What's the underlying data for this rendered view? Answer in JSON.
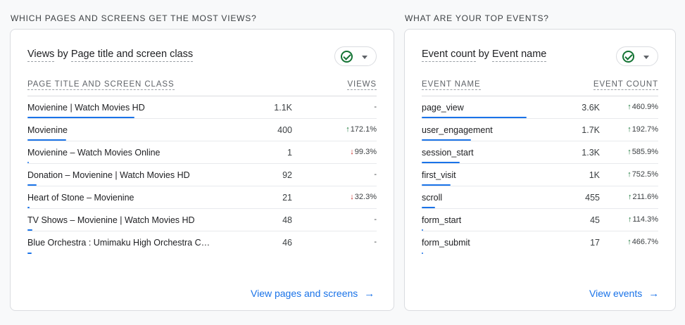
{
  "pages_section": {
    "heading": "WHICH PAGES AND SCREENS GET THE MOST VIEWS?",
    "card_title_metric": "Views",
    "card_title_by": "by",
    "card_title_dimension": "Page title and screen class",
    "col_name": "PAGE TITLE AND SCREEN CLASS",
    "col_value": "VIEWS",
    "max_value": 1100,
    "rows": [
      {
        "name": "Movienine | Watch Movies HD",
        "value": "1.1K",
        "value_num": 1100,
        "change": "-",
        "direction": "none"
      },
      {
        "name": "Movienine",
        "value": "400",
        "value_num": 400,
        "change": "172.1%",
        "direction": "up"
      },
      {
        "name": "Movienine – Watch Movies Online",
        "value": "1",
        "value_num": 1,
        "change": "99.3%",
        "direction": "down"
      },
      {
        "name": "Donation – Movienine | Watch Movies HD",
        "value": "92",
        "value_num": 92,
        "change": "-",
        "direction": "none"
      },
      {
        "name": "Heart of Stone – Movienine",
        "value": "21",
        "value_num": 21,
        "change": "32.3%",
        "direction": "down"
      },
      {
        "name": "TV Shows – Movienine | Watch Movies HD",
        "value": "48",
        "value_num": 48,
        "change": "-",
        "direction": "none"
      },
      {
        "name": "Blue Orchestra : Umimaku High Orchestra C…",
        "value": "46",
        "value_num": 46,
        "change": "-",
        "direction": "none"
      }
    ],
    "link_label": "View pages and screens"
  },
  "events_section": {
    "heading": "WHAT ARE YOUR TOP EVENTS?",
    "card_title_metric": "Event count",
    "card_title_by": "by",
    "card_title_dimension": "Event name",
    "col_name": "EVENT NAME",
    "col_value": "EVENT COUNT",
    "max_value": 3600,
    "rows": [
      {
        "name": "page_view",
        "value": "3.6K",
        "value_num": 3600,
        "change": "460.9%",
        "direction": "up"
      },
      {
        "name": "user_engagement",
        "value": "1.7K",
        "value_num": 1700,
        "change": "192.7%",
        "direction": "up"
      },
      {
        "name": "session_start",
        "value": "1.3K",
        "value_num": 1300,
        "change": "585.9%",
        "direction": "up"
      },
      {
        "name": "first_visit",
        "value": "1K",
        "value_num": 1000,
        "change": "752.5%",
        "direction": "up"
      },
      {
        "name": "scroll",
        "value": "455",
        "value_num": 455,
        "change": "211.6%",
        "direction": "up"
      },
      {
        "name": "form_start",
        "value": "45",
        "value_num": 45,
        "change": "114.3%",
        "direction": "up"
      },
      {
        "name": "form_submit",
        "value": "17",
        "value_num": 17,
        "change": "466.7%",
        "direction": "up"
      }
    ],
    "link_label": "View events"
  },
  "icons": {
    "status": "check-circle-icon",
    "dropdown": "caret-down-icon",
    "link": "arrow-right-icon",
    "up": "arrow-up-icon",
    "down": "arrow-down-icon"
  },
  "colors": {
    "accent": "#1a73e8",
    "up": "#137333",
    "down": "#c5221f"
  }
}
